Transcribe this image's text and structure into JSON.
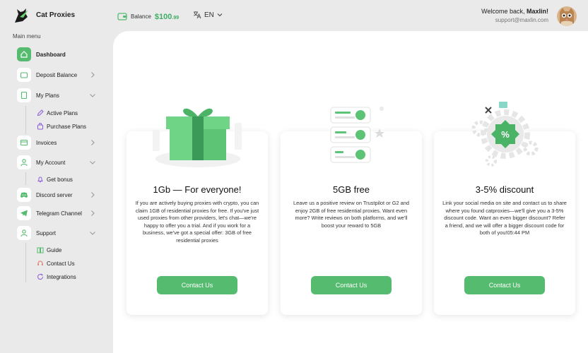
{
  "header": {
    "brand": "Cat Proxies",
    "balance_label": "Balance",
    "balance_value": "$100",
    "balance_cents": ".99",
    "language": "EN",
    "welcome_prefix": "Welcome back,",
    "user_name": "Maxlin!",
    "email": "support@maxlin.com"
  },
  "sidebar": {
    "title": "Main menu",
    "items": [
      {
        "label": "Dashboard"
      },
      {
        "label": "Deposit Balance"
      },
      {
        "label": "My Plans"
      },
      {
        "label": "Invoices"
      },
      {
        "label": "My Account"
      },
      {
        "label": "Discord server"
      },
      {
        "label": "Telegram Channel"
      },
      {
        "label": "Support"
      }
    ],
    "plans_sub": [
      {
        "label": "Active Plans"
      },
      {
        "label": "Purchase Plans"
      }
    ],
    "account_sub": [
      {
        "label": "Get bonus"
      }
    ],
    "support_sub": [
      {
        "label": "Guide"
      },
      {
        "label": "Contact Us"
      },
      {
        "label": "Integrations"
      }
    ]
  },
  "cards": [
    {
      "title": "1Gb — For everyone!",
      "text": "If you are actively buying proxies with crypto, you can claim 1GB of residential proxies for free. If you've just used proxies from other providers, let's chat—we're happy to offer you a trial. And if you work for a business, we've got a special offer: 3GB of free residential proxies",
      "button": "Contact Us"
    },
    {
      "title": "5GB free",
      "text": "Leave us a positive review on Trustpilot or G2 and enjoy 2GB of free residential proxies. Want even more? Write reviews on both platforms, and we'll boost your reward to 5GB",
      "button": "Contact Us"
    },
    {
      "title": "3-5% discount",
      "text": "Link your social media on site and contact us to share where you found catproxies—we'll give you a 3-5% discount code. Want an even bigger discount? Refer a friend, and we will offer a bigger discount code for both of you!05:44 PM",
      "button": "Contact Us"
    }
  ],
  "colors": {
    "accent": "#55bb6f",
    "balance": "#3fae63",
    "background": "#eaeaea"
  }
}
